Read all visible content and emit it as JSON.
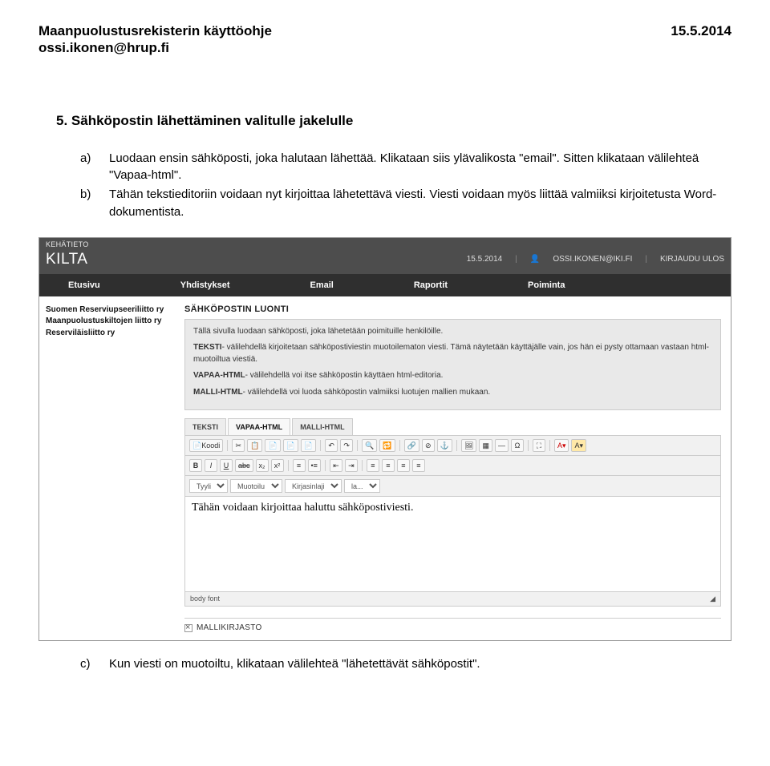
{
  "header": {
    "title": "Maanpuolustusrekisterin käyttöohje",
    "email": "ossi.ikonen@hrup.fi",
    "date": "15.5.2014"
  },
  "section": {
    "number": "5.",
    "title": "Sähköpostin lähettäminen valitulle jakelulle"
  },
  "steps": {
    "a_marker": "a)",
    "a_text": "Luodaan ensin sähköposti, joka halutaan lähettää. Klikataan siis ylävalikosta \"email\". Sitten klikataan välilehteä \"Vapaa-html\".",
    "b_marker": "b)",
    "b_text": "Tähän tekstieditoriin voidaan nyt kirjoittaa lähetettävä viesti. Viesti voidaan myös liittää valmiiksi kirjoitetusta Word-dokumentista.",
    "c_marker": "c)",
    "c_text": "Kun viesti on muotoiltu, klikataan välilehteä \"lähetettävät sähköpostit\"."
  },
  "app": {
    "topLabel": "KEHÄTIETO",
    "brand": "KILTA",
    "date": "15.5.2014",
    "user": "OSSI.IKONEN@IKI.FI",
    "logout": "KIRJAUDU ULOS",
    "nav": [
      "Etusivu",
      "Yhdistykset",
      "Email",
      "Raportit",
      "Poiminta"
    ],
    "sidebar": [
      "Suomen Reserviupseeriliitto ry",
      "Maanpuolustuskiltojen liitto ry",
      "Reserviläisliitto ry"
    ],
    "mainTitle": "SÄHKÖPOSTIN LUONTI",
    "info": {
      "p1": "Tällä sivulla luodaan sähköposti, joka lähetetään poimituille henkilöille.",
      "p2a": "TEKSTI",
      "p2b": "- välilehdellä kirjoitetaan sähköpostiviestin muotoilematon viesti. Tämä näytetään käyttäjälle vain, jos hän ei pysty ottamaan vastaan html-muotoiltua viestiä.",
      "p3a": "VAPAA-HTML",
      "p3b": "- välilehdellä voi itse sähköpostin käyttäen html-editoria.",
      "p4a": "MALLI-HTML",
      "p4b": "- välilehdellä voi luoda sähköpostin valmiiksi luotujen mallien mukaan."
    },
    "tabs": [
      "TEKSTI",
      "VAPAA-HTML",
      "MALLI-HTML"
    ],
    "activeTab": 1,
    "toolbar": {
      "koodi": "Koodi",
      "selects": [
        "Tyyli",
        "Muotoilu",
        "Kirjasinlaji",
        "la..."
      ]
    },
    "editorContent": "Tähän voidaan kirjoittaa haluttu sähköpostiviesti.",
    "status": "body  font",
    "mallikirjasto": "MALLIKIRJASTO"
  }
}
